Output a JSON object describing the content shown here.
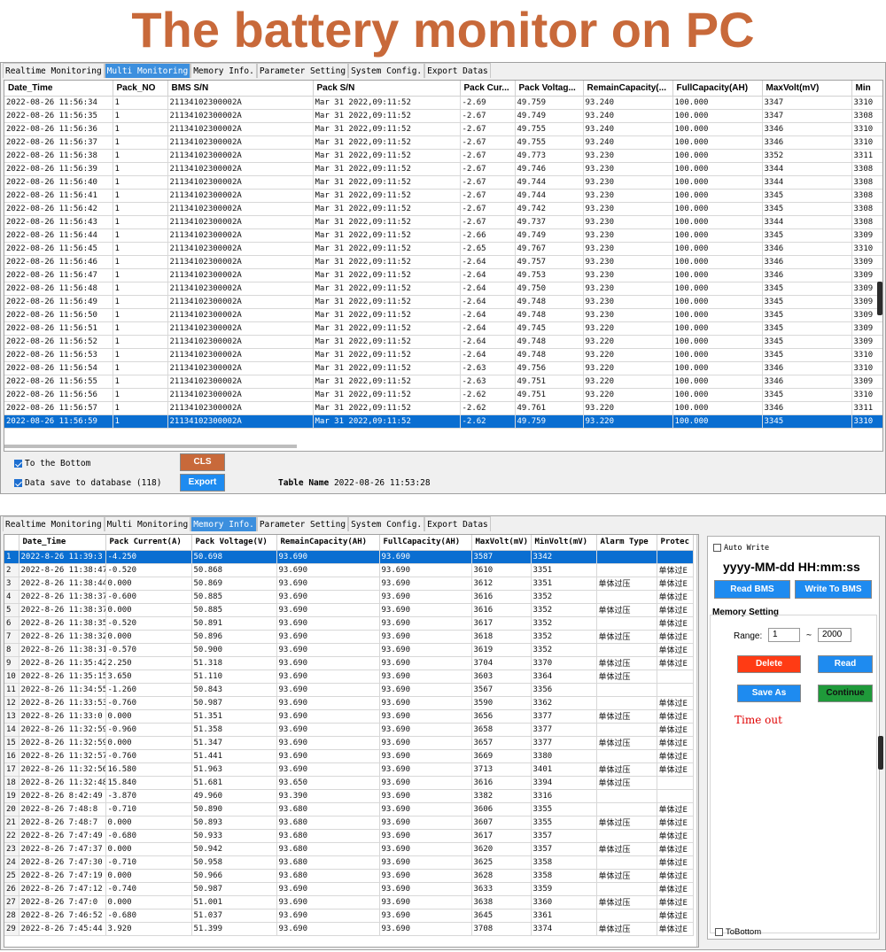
{
  "banner": {
    "title": "The battery monitor on PC"
  },
  "top": {
    "tabs": [
      "Realtime Monitoring",
      "Multi Monitoring",
      "Memory Info.",
      "Parameter Setting",
      "System Config.",
      "Export Datas"
    ],
    "active_tab": 1,
    "columns": [
      "Date_Time",
      "Pack_NO",
      "BMS S/N",
      "Pack S/N",
      "Pack Cur...",
      "Pack Voltag...",
      "RemainCapacity(...",
      "FullCapacity(AH)",
      "MaxVolt(mV)",
      "Min"
    ],
    "rows": [
      [
        "2022-08-26 11:56:34",
        "1",
        "21134102300002A",
        "Mar 31 2022,09:11:52",
        "-2.69",
        "49.759",
        "93.240",
        "100.000",
        "3347",
        "3310"
      ],
      [
        "2022-08-26 11:56:35",
        "1",
        "21134102300002A",
        "Mar 31 2022,09:11:52",
        "-2.67",
        "49.749",
        "93.240",
        "100.000",
        "3347",
        "3308"
      ],
      [
        "2022-08-26 11:56:36",
        "1",
        "21134102300002A",
        "Mar 31 2022,09:11:52",
        "-2.67",
        "49.755",
        "93.240",
        "100.000",
        "3346",
        "3310"
      ],
      [
        "2022-08-26 11:56:37",
        "1",
        "21134102300002A",
        "Mar 31 2022,09:11:52",
        "-2.67",
        "49.755",
        "93.240",
        "100.000",
        "3346",
        "3310"
      ],
      [
        "2022-08-26 11:56:38",
        "1",
        "21134102300002A",
        "Mar 31 2022,09:11:52",
        "-2.67",
        "49.773",
        "93.230",
        "100.000",
        "3352",
        "3311"
      ],
      [
        "2022-08-26 11:56:39",
        "1",
        "21134102300002A",
        "Mar 31 2022,09:11:52",
        "-2.67",
        "49.746",
        "93.230",
        "100.000",
        "3344",
        "3308"
      ],
      [
        "2022-08-26 11:56:40",
        "1",
        "21134102300002A",
        "Mar 31 2022,09:11:52",
        "-2.67",
        "49.744",
        "93.230",
        "100.000",
        "3344",
        "3308"
      ],
      [
        "2022-08-26 11:56:41",
        "1",
        "21134102300002A",
        "Mar 31 2022,09:11:52",
        "-2.67",
        "49.744",
        "93.230",
        "100.000",
        "3345",
        "3308"
      ],
      [
        "2022-08-26 11:56:42",
        "1",
        "21134102300002A",
        "Mar 31 2022,09:11:52",
        "-2.67",
        "49.742",
        "93.230",
        "100.000",
        "3345",
        "3308"
      ],
      [
        "2022-08-26 11:56:43",
        "1",
        "21134102300002A",
        "Mar 31 2022,09:11:52",
        "-2.67",
        "49.737",
        "93.230",
        "100.000",
        "3344",
        "3308"
      ],
      [
        "2022-08-26 11:56:44",
        "1",
        "21134102300002A",
        "Mar 31 2022,09:11:52",
        "-2.66",
        "49.749",
        "93.230",
        "100.000",
        "3345",
        "3309"
      ],
      [
        "2022-08-26 11:56:45",
        "1",
        "21134102300002A",
        "Mar 31 2022,09:11:52",
        "-2.65",
        "49.767",
        "93.230",
        "100.000",
        "3346",
        "3310"
      ],
      [
        "2022-08-26 11:56:46",
        "1",
        "21134102300002A",
        "Mar 31 2022,09:11:52",
        "-2.64",
        "49.757",
        "93.230",
        "100.000",
        "3346",
        "3309"
      ],
      [
        "2022-08-26 11:56:47",
        "1",
        "21134102300002A",
        "Mar 31 2022,09:11:52",
        "-2.64",
        "49.753",
        "93.230",
        "100.000",
        "3346",
        "3309"
      ],
      [
        "2022-08-26 11:56:48",
        "1",
        "21134102300002A",
        "Mar 31 2022,09:11:52",
        "-2.64",
        "49.750",
        "93.230",
        "100.000",
        "3345",
        "3309"
      ],
      [
        "2022-08-26 11:56:49",
        "1",
        "21134102300002A",
        "Mar 31 2022,09:11:52",
        "-2.64",
        "49.748",
        "93.230",
        "100.000",
        "3345",
        "3309"
      ],
      [
        "2022-08-26 11:56:50",
        "1",
        "21134102300002A",
        "Mar 31 2022,09:11:52",
        "-2.64",
        "49.748",
        "93.230",
        "100.000",
        "3345",
        "3309"
      ],
      [
        "2022-08-26 11:56:51",
        "1",
        "21134102300002A",
        "Mar 31 2022,09:11:52",
        "-2.64",
        "49.745",
        "93.220",
        "100.000",
        "3345",
        "3309"
      ],
      [
        "2022-08-26 11:56:52",
        "1",
        "21134102300002A",
        "Mar 31 2022,09:11:52",
        "-2.64",
        "49.748",
        "93.220",
        "100.000",
        "3345",
        "3309"
      ],
      [
        "2022-08-26 11:56:53",
        "1",
        "21134102300002A",
        "Mar 31 2022,09:11:52",
        "-2.64",
        "49.748",
        "93.220",
        "100.000",
        "3345",
        "3310"
      ],
      [
        "2022-08-26 11:56:54",
        "1",
        "21134102300002A",
        "Mar 31 2022,09:11:52",
        "-2.63",
        "49.756",
        "93.220",
        "100.000",
        "3346",
        "3310"
      ],
      [
        "2022-08-26 11:56:55",
        "1",
        "21134102300002A",
        "Mar 31 2022,09:11:52",
        "-2.63",
        "49.751",
        "93.220",
        "100.000",
        "3346",
        "3309"
      ],
      [
        "2022-08-26 11:56:56",
        "1",
        "21134102300002A",
        "Mar 31 2022,09:11:52",
        "-2.62",
        "49.751",
        "93.220",
        "100.000",
        "3345",
        "3310"
      ],
      [
        "2022-08-26 11:56:57",
        "1",
        "21134102300002A",
        "Mar 31 2022,09:11:52",
        "-2.62",
        "49.761",
        "93.220",
        "100.000",
        "3346",
        "3311"
      ],
      [
        "2022-08-26 11:56:59",
        "1",
        "21134102300002A",
        "Mar 31 2022,09:11:52",
        "-2.62",
        "49.759",
        "93.220",
        "100.000",
        "3345",
        "3310"
      ]
    ],
    "selected_row": 24,
    "to_bottom_label": "To the Bottom",
    "save_db_label": "Data save to database",
    "save_db_count": "(118)",
    "cls_label": "CLS",
    "export_label": "Export",
    "table_name_label": "Table Name",
    "table_name_value": "2022-08-26 11:53:28"
  },
  "bottom": {
    "tabs": [
      "Realtime Monitoring",
      "Multi Monitoring",
      "Memory Info.",
      "Parameter Setting",
      "System Config.",
      "Export Datas"
    ],
    "active_tab": 2,
    "columns": [
      "",
      "Date_Time",
      "Pack Current(A)",
      "Pack Voltage(V)",
      "RemainCapacity(AH)",
      "FullCapacity(AH)",
      "MaxVolt(mV)",
      "MinVolt(mV)",
      "Alarm Type",
      "Protec"
    ],
    "rows": [
      [
        "1",
        "2022-8-26 11:39:3",
        "-4.250",
        "50.698",
        "93.690",
        "93.690",
        "3587",
        "3342",
        "",
        ""
      ],
      [
        "2",
        "2022-8-26 11:38:47",
        "-0.520",
        "50.868",
        "93.690",
        "93.690",
        "3610",
        "3351",
        "",
        "单体过E"
      ],
      [
        "3",
        "2022-8-26 11:38:44",
        "0.000",
        "50.869",
        "93.690",
        "93.690",
        "3612",
        "3351",
        "单体过压",
        "单体过E"
      ],
      [
        "4",
        "2022-8-26 11:38:37",
        "-0.600",
        "50.885",
        "93.690",
        "93.690",
        "3616",
        "3352",
        "",
        "单体过E"
      ],
      [
        "5",
        "2022-8-26 11:38:37",
        "0.000",
        "50.885",
        "93.690",
        "93.690",
        "3616",
        "3352",
        "单体过压",
        "单体过E"
      ],
      [
        "6",
        "2022-8-26 11:38:35",
        "-0.520",
        "50.891",
        "93.690",
        "93.690",
        "3617",
        "3352",
        "",
        "单体过E"
      ],
      [
        "7",
        "2022-8-26 11:38:32",
        "0.000",
        "50.896",
        "93.690",
        "93.690",
        "3618",
        "3352",
        "单体过压",
        "单体过E"
      ],
      [
        "8",
        "2022-8-26 11:38:31",
        "-0.570",
        "50.900",
        "93.690",
        "93.690",
        "3619",
        "3352",
        "",
        "单体过E"
      ],
      [
        "9",
        "2022-8-26 11:35:42",
        "2.250",
        "51.318",
        "93.690",
        "93.690",
        "3704",
        "3370",
        "单体过压",
        "单体过E"
      ],
      [
        "10",
        "2022-8-26 11:35:15",
        "3.650",
        "51.110",
        "93.690",
        "93.690",
        "3603",
        "3364",
        "单体过压",
        ""
      ],
      [
        "11",
        "2022-8-26 11:34:55",
        "-1.260",
        "50.843",
        "93.690",
        "93.690",
        "3567",
        "3356",
        "",
        ""
      ],
      [
        "12",
        "2022-8-26 11:33:53",
        "-0.760",
        "50.987",
        "93.690",
        "93.690",
        "3590",
        "3362",
        "",
        "单体过E"
      ],
      [
        "13",
        "2022-8-26 11:33:0",
        "0.000",
        "51.351",
        "93.690",
        "93.690",
        "3656",
        "3377",
        "单体过压",
        "单体过E"
      ],
      [
        "14",
        "2022-8-26 11:32:59",
        "-0.960",
        "51.358",
        "93.690",
        "93.690",
        "3658",
        "3377",
        "",
        "单体过E"
      ],
      [
        "15",
        "2022-8-26 11:32:59",
        "0.000",
        "51.347",
        "93.690",
        "93.690",
        "3657",
        "3377",
        "单体过压",
        "单体过E"
      ],
      [
        "16",
        "2022-8-26 11:32:57",
        "-0.760",
        "51.441",
        "93.690",
        "93.690",
        "3669",
        "3380",
        "",
        "单体过E"
      ],
      [
        "17",
        "2022-8-26 11:32:56",
        "16.580",
        "51.963",
        "93.690",
        "93.690",
        "3713",
        "3401",
        "单体过压",
        "单体过E"
      ],
      [
        "18",
        "2022-8-26 11:32:48",
        "15.840",
        "51.681",
        "93.650",
        "93.690",
        "3616",
        "3394",
        "单体过压",
        ""
      ],
      [
        "19",
        "2022-8-26 8:42:49",
        "-3.870",
        "49.960",
        "93.390",
        "93.690",
        "3382",
        "3316",
        "",
        ""
      ],
      [
        "20",
        "2022-8-26 7:48:8",
        "-0.710",
        "50.890",
        "93.680",
        "93.690",
        "3606",
        "3355",
        "",
        "单体过E"
      ],
      [
        "21",
        "2022-8-26 7:48:7",
        "0.000",
        "50.893",
        "93.680",
        "93.690",
        "3607",
        "3355",
        "单体过压",
        "单体过E"
      ],
      [
        "22",
        "2022-8-26 7:47:49",
        "-0.680",
        "50.933",
        "93.680",
        "93.690",
        "3617",
        "3357",
        "",
        "单体过E"
      ],
      [
        "23",
        "2022-8-26 7:47:37",
        "0.000",
        "50.942",
        "93.680",
        "93.690",
        "3620",
        "3357",
        "单体过压",
        "单体过E"
      ],
      [
        "24",
        "2022-8-26 7:47:30",
        "-0.710",
        "50.958",
        "93.680",
        "93.690",
        "3625",
        "3358",
        "",
        "单体过E"
      ],
      [
        "25",
        "2022-8-26 7:47:19",
        "0.000",
        "50.966",
        "93.680",
        "93.690",
        "3628",
        "3358",
        "单体过压",
        "单体过E"
      ],
      [
        "26",
        "2022-8-26 7:47:12",
        "-0.740",
        "50.987",
        "93.690",
        "93.690",
        "3633",
        "3359",
        "",
        "单体过E"
      ],
      [
        "27",
        "2022-8-26 7:47:0",
        "0.000",
        "51.001",
        "93.690",
        "93.690",
        "3638",
        "3360",
        "单体过压",
        "单体过E"
      ],
      [
        "28",
        "2022-8-26 7:46:52",
        "-0.680",
        "51.037",
        "93.690",
        "93.690",
        "3645",
        "3361",
        "",
        "单体过E"
      ],
      [
        "29",
        "2022-8-26 7:45:44",
        "3.920",
        "51.399",
        "93.690",
        "93.690",
        "3708",
        "3374",
        "单体过压",
        "单体过E"
      ]
    ],
    "selected_row": 0,
    "auto_write_label": "Auto Write",
    "datetime_format": "yyyy-MM-dd HH:mm:ss",
    "read_bms_label": "Read BMS",
    "write_bms_label": "Write To BMS",
    "memory_setting_label": "Memory Setting",
    "range_label": "Range:",
    "range_from": "1",
    "range_sep": "~",
    "range_to": "2000",
    "delete_label": "Delete",
    "read_label": "Read",
    "save_as_label": "Save As",
    "continue_label": "Continue",
    "timeout_label": "Time out",
    "to_bottom_label": "ToBottom"
  }
}
